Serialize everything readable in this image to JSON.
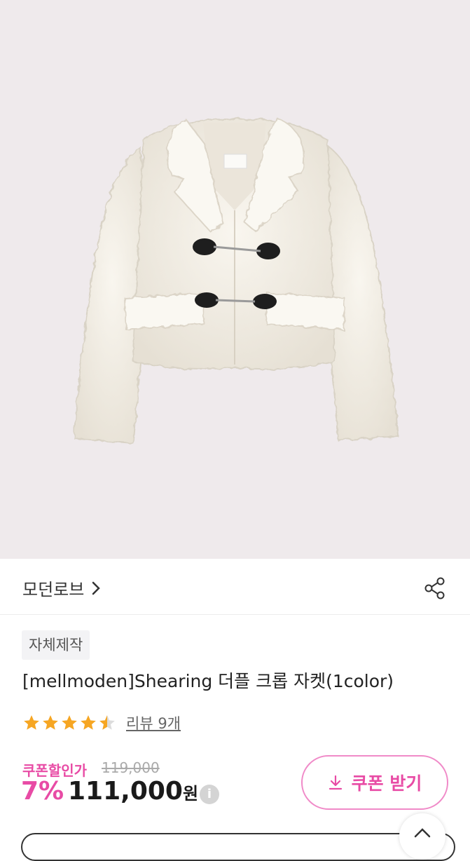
{
  "product_image": {
    "alt": "product-photo",
    "background": "#efeaec"
  },
  "brand": {
    "name": "모던로브",
    "icon": "chevron-right-icon"
  },
  "share": {
    "icon": "share-icon"
  },
  "tag": {
    "label": "자체제작"
  },
  "product": {
    "title": "[mellmoden]Shearing 더플 크롭 자켓(1color)",
    "rating": 4.5,
    "review_text": "리뷰 9개"
  },
  "pricing": {
    "coupon_label": "쿠폰할인가",
    "original_price": "119,000",
    "discount": "7%",
    "price": "111,000",
    "currency": "원",
    "accent_color": "#e84ba5"
  },
  "coupon_button": {
    "label": "쿠폰 받기",
    "icon": "download-icon"
  },
  "scroll_top": {
    "icon": "chevron-up-icon"
  }
}
